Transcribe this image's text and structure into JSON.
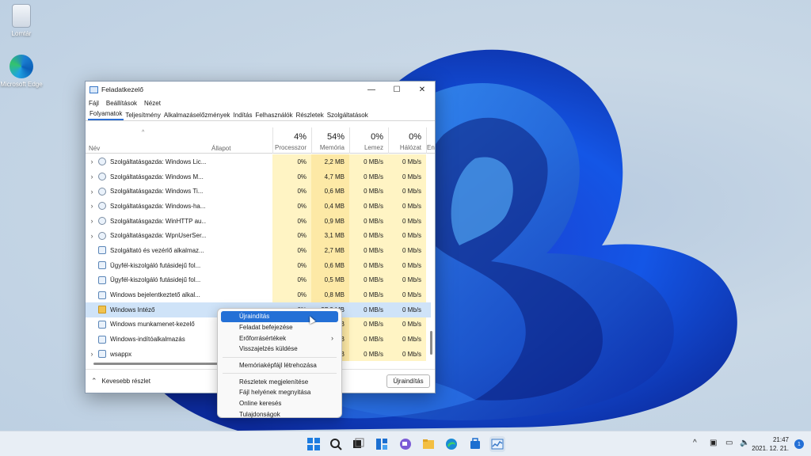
{
  "desktop": {
    "icons": [
      {
        "label": "Lomtár",
        "icon": "recycle-bin-icon"
      },
      {
        "label": "Microsoft Edge",
        "icon": "edge-icon"
      }
    ]
  },
  "window": {
    "title": "Feladatkezelő",
    "controls": {
      "minimize": "—",
      "maximize": "☐",
      "close": "✕"
    },
    "menu": [
      "Fájl",
      "Beállítások",
      "Nézet"
    ],
    "tabs": [
      "Folyamatok",
      "Teljesítmény",
      "Alkalmazáselőzmények",
      "Indítás",
      "Felhasználók",
      "Részletek",
      "Szolgáltatások"
    ],
    "active_tab": "Folyamatok",
    "columns": {
      "name": "Név",
      "status": "Állapot",
      "cpu": {
        "pct": "4%",
        "label": "Processzor"
      },
      "memory": {
        "pct": "54%",
        "label": "Memória"
      },
      "disk": {
        "pct": "0%",
        "label": "Lemez"
      },
      "network": {
        "pct": "0%",
        "label": "Hálózat"
      },
      "energy_label": "En"
    },
    "rows": [
      {
        "expand": "›",
        "icon": "service",
        "name": "Szolgáltatásgazda: Windows Lic...",
        "cpu": "0%",
        "mem": "2,2 MB",
        "disk": "0 MB/s",
        "net": "0 Mb/s"
      },
      {
        "expand": "›",
        "icon": "service",
        "name": "Szolgáltatásgazda: Windows M...",
        "cpu": "0%",
        "mem": "4,7 MB",
        "disk": "0 MB/s",
        "net": "0 Mb/s"
      },
      {
        "expand": "›",
        "icon": "service",
        "name": "Szolgáltatásgazda: Windows Ti...",
        "cpu": "0%",
        "mem": "0,6 MB",
        "disk": "0 MB/s",
        "net": "0 Mb/s"
      },
      {
        "expand": "›",
        "icon": "service",
        "name": "Szolgáltatásgazda: Windows-ha...",
        "cpu": "0%",
        "mem": "0,4 MB",
        "disk": "0 MB/s",
        "net": "0 Mb/s"
      },
      {
        "expand": "›",
        "icon": "service",
        "name": "Szolgáltatásgazda: WinHTTP au...",
        "cpu": "0%",
        "mem": "0,9 MB",
        "disk": "0 MB/s",
        "net": "0 Mb/s"
      },
      {
        "expand": "›",
        "icon": "service",
        "name": "Szolgáltatásgazda: WpnUserSer...",
        "cpu": "0%",
        "mem": "3,1 MB",
        "disk": "0 MB/s",
        "net": "0 Mb/s"
      },
      {
        "expand": "",
        "icon": "app",
        "name": "Szolgáltató és vezérlő alkalmaz...",
        "cpu": "0%",
        "mem": "2,7 MB",
        "disk": "0 MB/s",
        "net": "0 Mb/s"
      },
      {
        "expand": "",
        "icon": "app",
        "name": "Ügyfél-kiszolgáló futásidejű fol...",
        "cpu": "0%",
        "mem": "0,6 MB",
        "disk": "0 MB/s",
        "net": "0 Mb/s"
      },
      {
        "expand": "",
        "icon": "app",
        "name": "Ügyfél-kiszolgáló futásidejű fol...",
        "cpu": "0%",
        "mem": "0,5 MB",
        "disk": "0 MB/s",
        "net": "0 Mb/s"
      },
      {
        "expand": "",
        "icon": "app",
        "name": "Windows bejelentkeztető alkal...",
        "cpu": "0%",
        "mem": "0,8 MB",
        "disk": "0 MB/s",
        "net": "0 Mb/s"
      },
      {
        "expand": "",
        "icon": "folder",
        "name": "Windows Intéző",
        "cpu": "0%",
        "mem": "37,9 MB",
        "disk": "0 MB/s",
        "net": "0 Mb/s",
        "selected": true
      },
      {
        "expand": "",
        "icon": "app",
        "name": "Windows munkamenet-kezelő",
        "cpu": "",
        "mem": "B",
        "disk": "0 MB/s",
        "net": "0 Mb/s"
      },
      {
        "expand": "",
        "icon": "app",
        "name": "Windows-indítóalkalmazás",
        "cpu": "",
        "mem": "B",
        "disk": "0 MB/s",
        "net": "0 Mb/s"
      },
      {
        "expand": "›",
        "icon": "app",
        "name": "wsappx",
        "cpu": "",
        "mem": "B",
        "disk": "0 MB/s",
        "net": "0 Mb/s"
      }
    ],
    "footer": {
      "less_details": "Kevesebb részlet",
      "restart": "Újraindítás"
    }
  },
  "context_menu": {
    "groups": [
      [
        "Újraindítás",
        "Feladat befejezése",
        "Erőforrásértékek",
        "Visszajelzés küldése"
      ],
      [
        "Memóriaképfájl létrehozása"
      ],
      [
        "Részletek megjelenítése",
        "Fájl helyének megnyitása",
        "Online keresés",
        "Tulajdonságok"
      ]
    ],
    "highlighted": "Újraindítás",
    "submenu_item": "Erőforrásértékek"
  },
  "taskbar": {
    "apps": [
      "start-icon",
      "search-icon",
      "task-view-icon",
      "widgets-icon",
      "chat-icon",
      "file-explorer-icon",
      "edge-icon",
      "store-icon",
      "task-manager-icon"
    ],
    "tray": {
      "chevron": "^",
      "network": "▣",
      "volume": "🔈"
    },
    "time": "21:47",
    "date": "2021. 12. 21.",
    "notifications": "1"
  }
}
